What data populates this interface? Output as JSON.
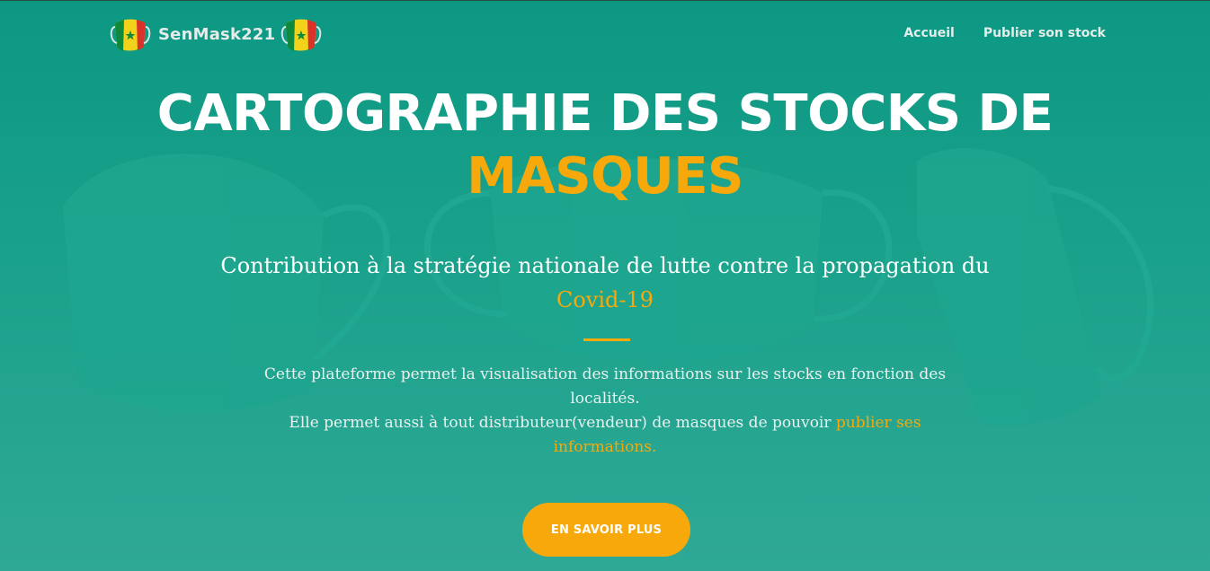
{
  "brand": {
    "name": "SenMask221",
    "flag_colors": [
      "#0f8a3c",
      "#f2d21b",
      "#d8322b"
    ]
  },
  "nav": {
    "links": [
      "Accueil",
      "Publier son stock"
    ]
  },
  "hero": {
    "title_line1": "CARTOGRAPHIE DES STOCKS DE",
    "title_line2": "MASQUES",
    "subtitle": "Contribution à la stratégie nationale de lutte contre la propagation du",
    "subtitle_accent": "Covid-19",
    "description_line1": "Cette plateforme permet la visualisation des informations sur les stocks en fonction des localités.",
    "description_line2": "Elle permet aussi à tout distributeur(vendeur) de masques de pouvoir",
    "description_link": "publier ses informations.",
    "cta_label": "EN SAVOIR PLUS"
  },
  "colors": {
    "accent": "#f7a90b",
    "background": "#1aa18b",
    "text": "#ffffff"
  }
}
